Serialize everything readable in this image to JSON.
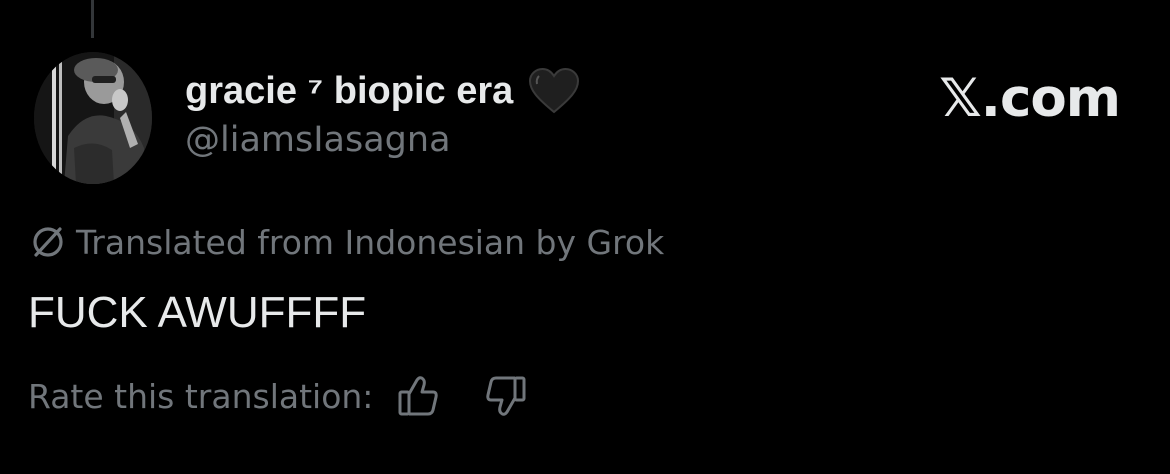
{
  "author": {
    "display_name": "gracie ⁷ biopic era",
    "handle": "@liamsIasagna"
  },
  "brand": {
    "label": "𝕏.com"
  },
  "translation": {
    "notice": "Translated from Indonesian by Grok",
    "rate_label": "Rate this translation:"
  },
  "tweet": {
    "text": "FUCK AWUFFFF"
  },
  "icons": {
    "heart": "black-heart-icon",
    "translate": "translate-icon",
    "thumbs_up": "thumbs-up-icon",
    "thumbs_down": "thumbs-down-icon"
  },
  "colors": {
    "background": "#000000",
    "primary_text": "#e7e9ea",
    "secondary_text": "#71767b"
  }
}
